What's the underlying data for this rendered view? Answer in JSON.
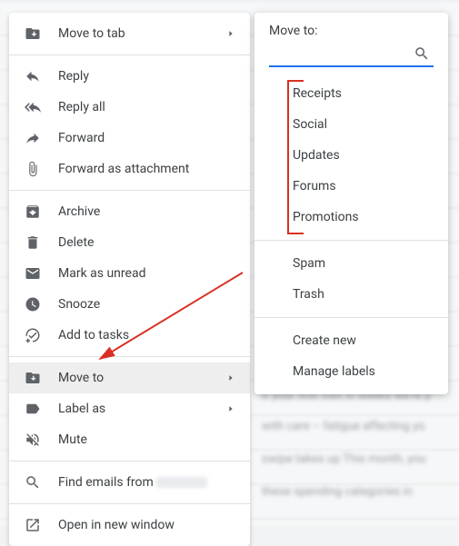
{
  "menu": {
    "move_to_tab": "Move to tab",
    "reply": "Reply",
    "reply_all": "Reply all",
    "forward": "Forward",
    "forward_attach": "Forward as attachment",
    "archive": "Archive",
    "delete": "Delete",
    "mark_unread": "Mark as unread",
    "snooze": "Snooze",
    "add_tasks": "Add to tasks",
    "move_to": "Move to",
    "label_as": "Label as",
    "mute": "Mute",
    "find_emails": "Find emails from ",
    "open_window": "Open in new window"
  },
  "submenu": {
    "title": "Move to:",
    "search_placeholder": "",
    "items": {
      "receipts": "Receipts",
      "social": "Social",
      "updates": "Updates",
      "forums": "Forums",
      "promotions": "Promotions",
      "spam": "Spam",
      "trash": "Trash",
      "create_new": "Create new",
      "manage_labels": "Manage labels"
    }
  }
}
